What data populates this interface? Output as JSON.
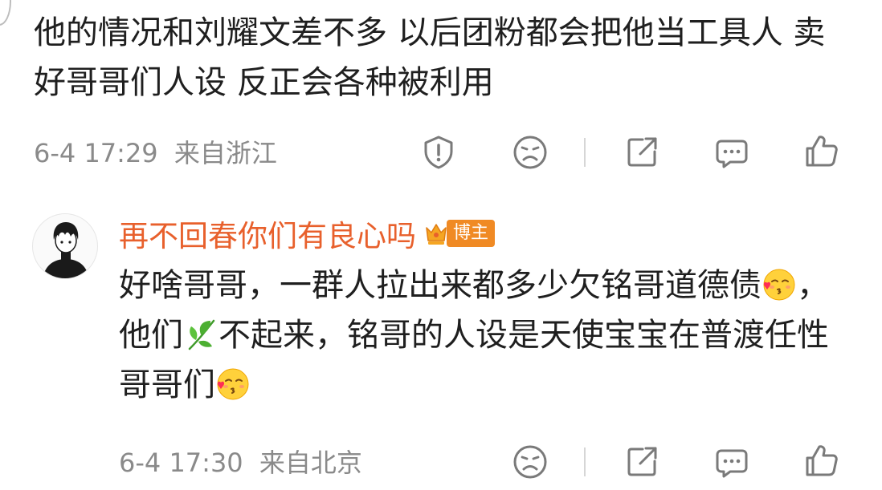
{
  "comments": [
    {
      "text": "他的情况和刘耀文差不多 以后团粉都会把他当工具人 卖好哥哥们人设 反正会各种被利用",
      "time": "6-4 17:29",
      "location": "来自浙江"
    },
    {
      "author": "再不回春你们有良心吗",
      "badge": "博主",
      "text_parts": [
        "好啥哥哥，一群人拉出来都多少欠铭哥道德债",
        "，他们",
        "不起来，铭哥的人设是天使宝宝在普渡任性哥哥们"
      ],
      "emojis": [
        "kiss-emoji",
        "herb-emoji",
        "kiss-emoji"
      ],
      "time": "6-4 17:30",
      "location": "来自北京"
    }
  ],
  "icons": {
    "report": "report-icon",
    "dislike": "sad-face-icon",
    "share": "share-icon",
    "reply": "comment-icon",
    "like": "thumbs-up-icon"
  },
  "colors": {
    "author": "#e8602c",
    "badge": "#f08a24",
    "meta": "#8a8a8a",
    "icon": "#7a7a7a"
  }
}
